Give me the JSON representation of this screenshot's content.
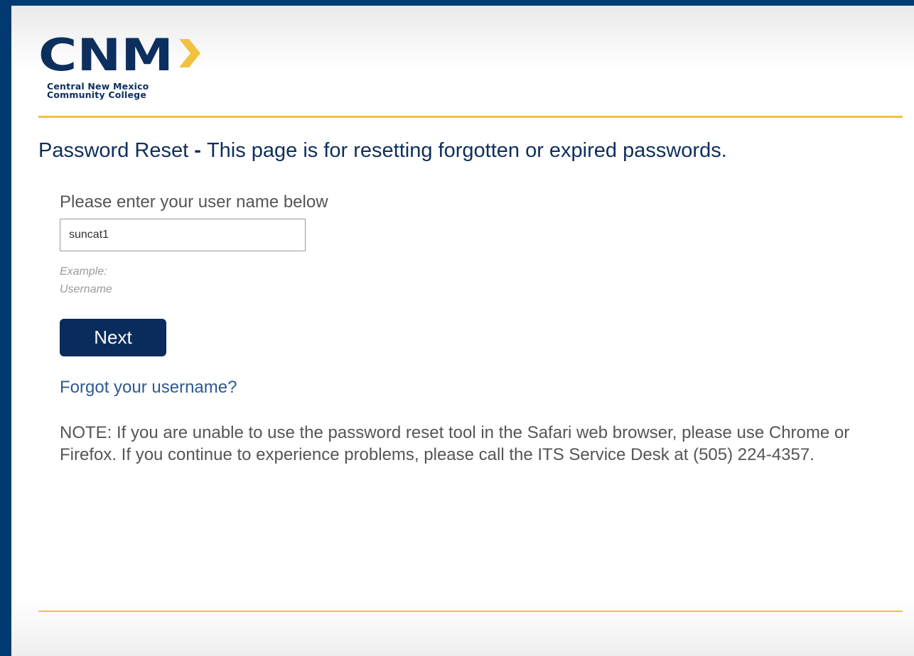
{
  "logo": {
    "wordmark": "CNM",
    "college_line1": "Central New Mexico",
    "college_line2": "Community College",
    "navy": "#003a70",
    "gold": "#f2c140",
    "arrow_icon": "chevron-right"
  },
  "title": {
    "prefix": "Password Reset",
    "separator": " - ",
    "text": "This page is for resetting forgotten or expired passwords."
  },
  "form": {
    "prompt": "Please enter your user name below",
    "username_value": "suncat1",
    "example_line1": "Example:",
    "example_line2": "Username",
    "next_label": "Next"
  },
  "links": {
    "forgot_username": "Forgot your username?"
  },
  "note": "NOTE: If you are unable to use the password reset tool in the Safari web browser, please use Chrome or Firefox. If you continue to experience problems, please call the ITS Service Desk at (505) 224-4357.",
  "colors": {
    "page_background": "#003a70",
    "accent_rule": "#f2c140",
    "button": "#0a2c5c",
    "link": "#2d5a91",
    "title": "#0d2f5e"
  }
}
